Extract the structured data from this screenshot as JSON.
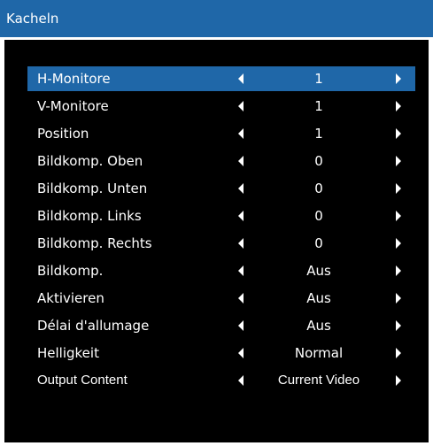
{
  "title": "Kacheln",
  "rows": [
    {
      "label": "H-Monitore",
      "value": "1"
    },
    {
      "label": "V-Monitore",
      "value": "1"
    },
    {
      "label": "Position",
      "value": "1"
    },
    {
      "label": "Bildkomp. Oben",
      "value": "0"
    },
    {
      "label": "Bildkomp. Unten",
      "value": "0"
    },
    {
      "label": "Bildkomp. Links",
      "value": "0"
    },
    {
      "label": "Bildkomp. Rechts",
      "value": "0"
    },
    {
      "label": "Bildkomp.",
      "value": "Aus"
    },
    {
      "label": "Aktivieren",
      "value": "Aus"
    },
    {
      "label": "Délai d'allumage",
      "value": "Aus"
    },
    {
      "label": "Helligkeit",
      "value": "Normal"
    },
    {
      "label": "Output Content",
      "value": "Current Video"
    }
  ],
  "selected_index": 0,
  "colors": {
    "accent": "#1f67a8",
    "panel": "#000000",
    "text": "#ffffff"
  },
  "icons": {
    "decrease": "triangle-left-icon",
    "increase": "triangle-right-icon"
  }
}
